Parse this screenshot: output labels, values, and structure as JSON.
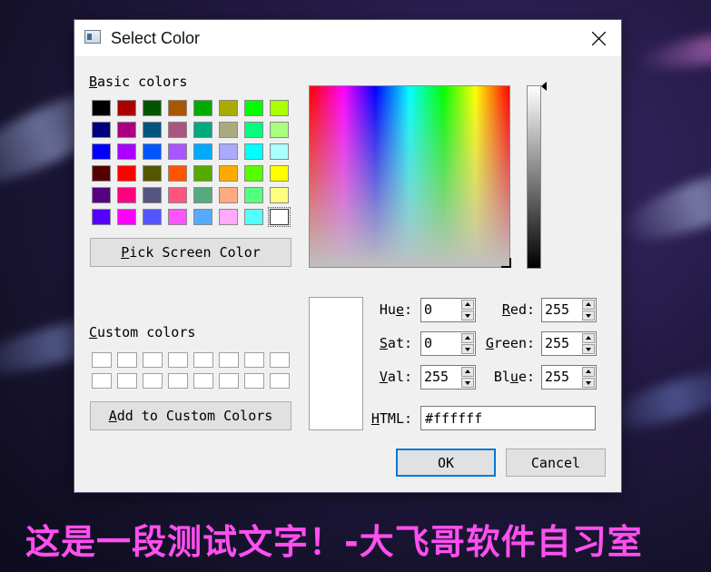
{
  "window": {
    "title": "Select Color"
  },
  "basic_colors": {
    "label": "Basic colors",
    "rows": [
      [
        "#000000",
        "#aa0000",
        "#005500",
        "#aa5500",
        "#00aa00",
        "#aaaa00",
        "#00ff00",
        "#aaff00"
      ],
      [
        "#00007f",
        "#aa007f",
        "#00557f",
        "#aa557f",
        "#00aa7f",
        "#aaaa7f",
        "#00ff7f",
        "#aaff7f"
      ],
      [
        "#0000ff",
        "#aa00ff",
        "#0055ff",
        "#aa55ff",
        "#00aaff",
        "#aaaaff",
        "#00ffff",
        "#aaffff"
      ],
      [
        "#550000",
        "#ff0000",
        "#555500",
        "#ff5500",
        "#55aa00",
        "#ffaa00",
        "#55ff00",
        "#ffff00"
      ],
      [
        "#55007f",
        "#ff007f",
        "#55557f",
        "#ff557f",
        "#55aa7f",
        "#ffaa7f",
        "#55ff7f",
        "#ffff7f"
      ],
      [
        "#5500ff",
        "#ff00ff",
        "#5555ff",
        "#ff55ff",
        "#55aaff",
        "#ffaaff",
        "#55ffff",
        "#ffffff"
      ]
    ],
    "selected": "#ffffff"
  },
  "pick_screen_label": "Pick Screen Color",
  "custom_colors": {
    "label": "Custom colors",
    "count": 16
  },
  "add_custom_label": "Add to Custom Colors",
  "fields": {
    "hue": {
      "label": "Hue:",
      "value": "0"
    },
    "sat": {
      "label": "Sat:",
      "value": "0"
    },
    "val": {
      "label": "Val:",
      "value": "255"
    },
    "red": {
      "label": "Red:",
      "value": "255"
    },
    "green": {
      "label": "Green:",
      "value": "255"
    },
    "blue": {
      "label": "Blue:",
      "value": "255"
    }
  },
  "html": {
    "label": "HTML:",
    "value": "#ffffff"
  },
  "ok_label": "OK",
  "cancel_label": "Cancel",
  "current_color": "#ffffff",
  "caption": "这是一段测试文字！-大飞哥软件自习室"
}
